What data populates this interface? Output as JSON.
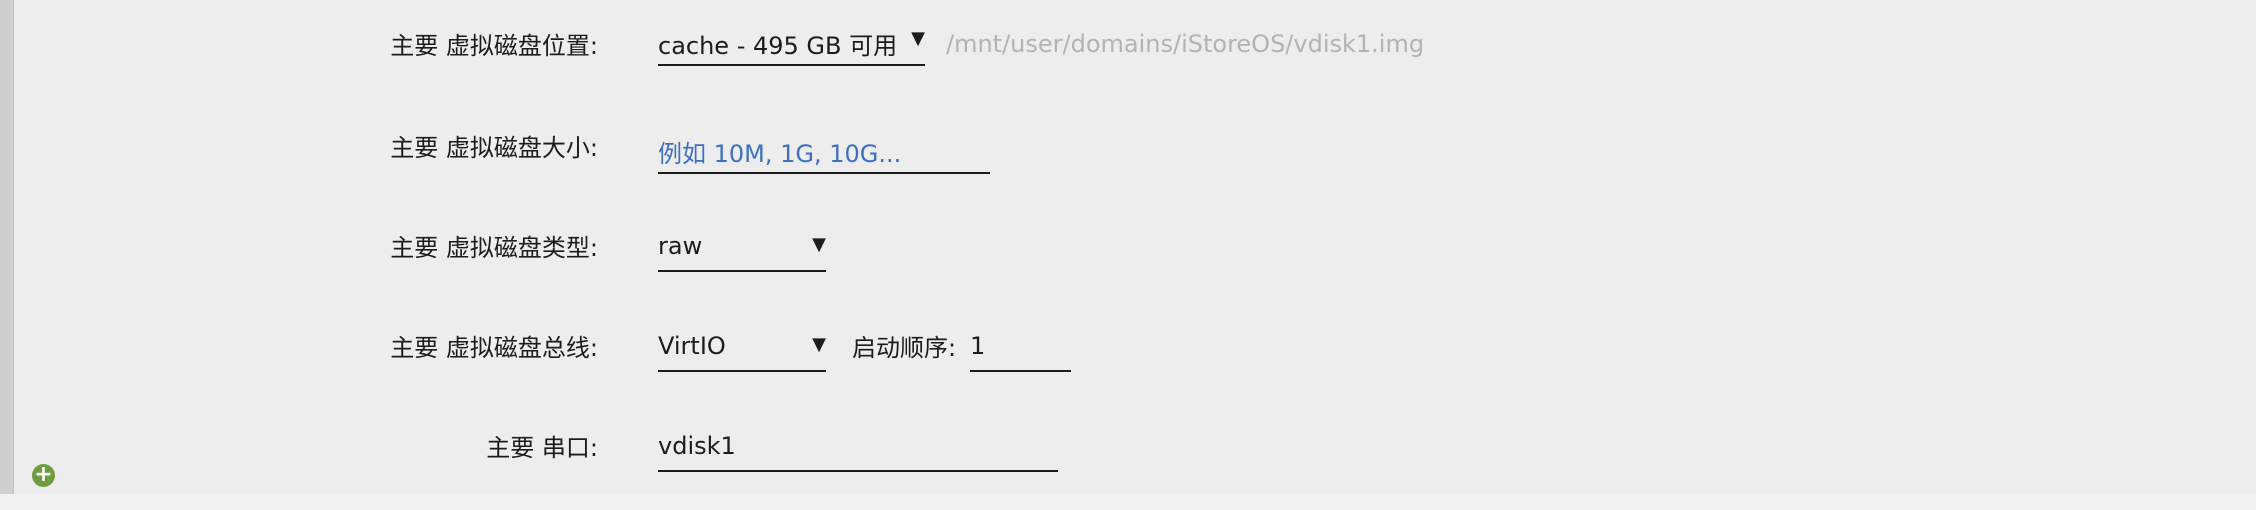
{
  "form": {
    "location": {
      "label": "主要 虚拟磁盘位置:",
      "value": "cache - 495 GB 可用",
      "path": "/mnt/user/domains/iStoreOS/vdisk1.img"
    },
    "size": {
      "label": "主要 虚拟磁盘大小:",
      "placeholder": "例如 10M, 1G, 10G..."
    },
    "type": {
      "label": "主要 虚拟磁盘类型:",
      "value": "raw"
    },
    "bus": {
      "label": "主要 虚拟磁盘总线:",
      "value": "VirtIO",
      "boot_order_label": "启动顺序:",
      "boot_order_value": "1"
    },
    "serial": {
      "label": "主要 串口:",
      "value": "vdisk1"
    }
  },
  "icons": {
    "dropdown": "▼",
    "add": "+"
  },
  "colors": {
    "background": "#ededed",
    "text": "#1c1c1c",
    "placeholder": "#3d6fc2",
    "muted": "#b3b3b3",
    "add_button": "#6d9d3d"
  }
}
